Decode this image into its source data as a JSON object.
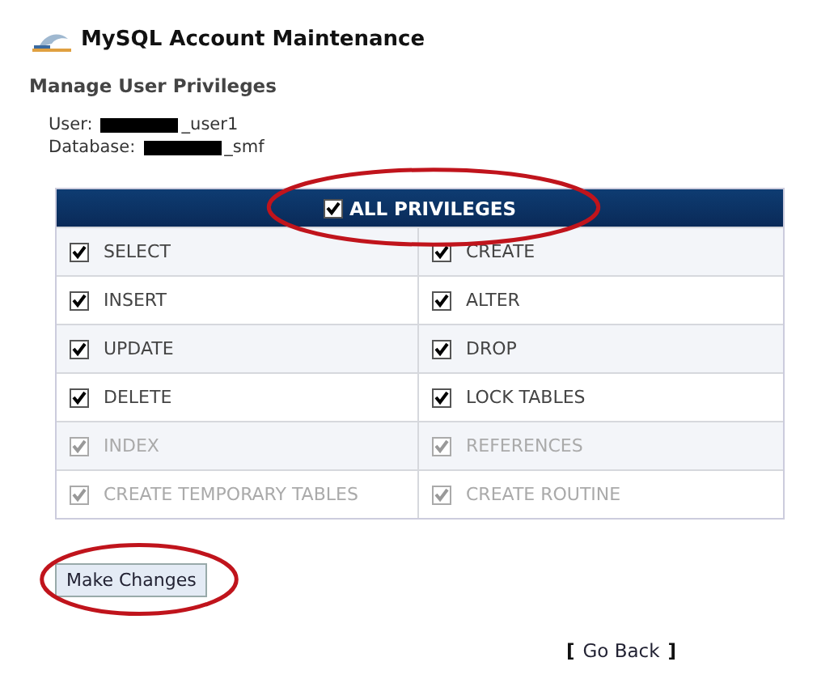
{
  "header": {
    "title": "MySQL Account Maintenance"
  },
  "section_title": "Manage User Privileges",
  "account": [
    {
      "label": "User:",
      "value": "_user1",
      "redacted": true
    },
    {
      "label": "Database:",
      "value": "_smf",
      "redacted": true
    }
  ],
  "all_privileges": {
    "label": "ALL PRIVILEGES",
    "checked": true,
    "circled": true
  },
  "privileges": [
    {
      "label": "SELECT",
      "checked": true,
      "disabled": false
    },
    {
      "label": "CREATE",
      "checked": true,
      "disabled": false
    },
    {
      "label": "INSERT",
      "checked": true,
      "disabled": false
    },
    {
      "label": "ALTER",
      "checked": true,
      "disabled": false
    },
    {
      "label": "UPDATE",
      "checked": true,
      "disabled": false
    },
    {
      "label": "DROP",
      "checked": true,
      "disabled": false
    },
    {
      "label": "DELETE",
      "checked": true,
      "disabled": false
    },
    {
      "label": "LOCK TABLES",
      "checked": true,
      "disabled": false
    },
    {
      "label": "INDEX",
      "checked": true,
      "disabled": true
    },
    {
      "label": "REFERENCES",
      "checked": true,
      "disabled": true
    },
    {
      "label": "CREATE TEMPORARY TABLES",
      "checked": true,
      "disabled": true
    },
    {
      "label": "CREATE ROUTINE",
      "checked": true,
      "disabled": true
    }
  ],
  "submit_button": {
    "label": "Make Changes",
    "circled": true
  },
  "go_back": {
    "open": "[",
    "label": "Go Back",
    "close": "]"
  }
}
